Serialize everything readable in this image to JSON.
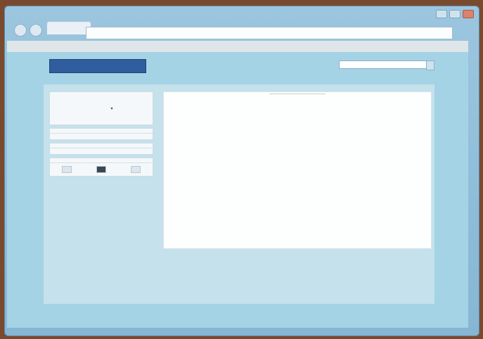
{
  "browser": {
    "tab_title": "",
    "address": ""
  },
  "menubar": {
    "items": [
      "",
      "",
      ""
    ],
    "right": ""
  },
  "site": {
    "logo": "",
    "search_placeholder": ""
  },
  "sidebar": {
    "language_select": "",
    "box1": {
      "title": "",
      "lines": [
        "",
        ""
      ]
    },
    "box2": {
      "title": "",
      "lines": [
        "",
        ""
      ]
    },
    "box3": {
      "title": ""
    }
  },
  "article": {
    "caption": "",
    "title": "",
    "paragraphs": [
      "",
      "",
      "",
      "",
      ""
    ],
    "link_text": ""
  },
  "colors": {
    "accent": "#2f5d9d",
    "frame": "#9cc6df",
    "page_bg": "#a5d3e6"
  }
}
